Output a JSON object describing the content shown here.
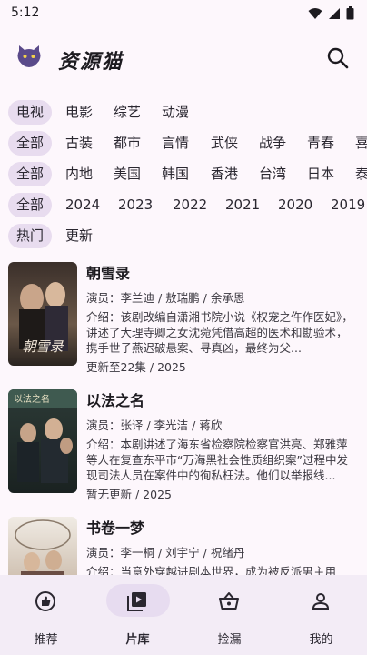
{
  "status": {
    "time": "5:12"
  },
  "app": {
    "title": "资源猫"
  },
  "filters": {
    "row1": [
      "电视",
      "电影",
      "综艺",
      "动漫"
    ],
    "row2": [
      "全部",
      "古装",
      "都市",
      "言情",
      "武侠",
      "战争",
      "青春",
      "喜"
    ],
    "row3": [
      "全部",
      "内地",
      "美国",
      "韩国",
      "香港",
      "台湾",
      "日本",
      "泰"
    ],
    "row4": [
      "全部",
      "2024",
      "2023",
      "2022",
      "2021",
      "2020",
      "2019"
    ],
    "row5": [
      "热门",
      "更新"
    ]
  },
  "items": [
    {
      "title": "朝雪录",
      "cast": "演员：李兰迪 / 敖瑞鹏 / 余承恩",
      "desc": "介绍：该剧改编自潇湘书院小说《权宠之仵作医妃》，讲述了大理寺卿之女沈菀凭借高超的医术和勘验术，携手世子燕迟破悬案、寻真凶，最终为父...",
      "meta": "更新至22集 / 2025",
      "poster_text": "朝雪录"
    },
    {
      "title": "以法之名",
      "cast": "演员：张译 / 李光洁 / 蒋欣",
      "desc": "介绍：本剧讲述了海东省检察院检察官洪亮、郑雅萍等人在复查东平市“万海黑社会性质组织案”过程中发现司法人员在案件中的徇私枉法。他们以举报线...",
      "meta": "暂无更新 / 2025",
      "poster_text": "以法之名"
    },
    {
      "title": "书卷一梦",
      "cast": "演员：李一桐 / 刘宇宁 / 祝绪丹",
      "desc": "介绍：当意外穿越进剧本世界，成为被反派男主用",
      "meta": "",
      "poster_text": ""
    }
  ],
  "nav": [
    "推荐",
    "片库",
    "捡漏",
    "我的"
  ],
  "colors": {
    "background": "#fdf7fc",
    "chip_selected": "#e8dcef",
    "nav_bg": "#f3ecf6",
    "nav_active": "#e7dcf0"
  }
}
